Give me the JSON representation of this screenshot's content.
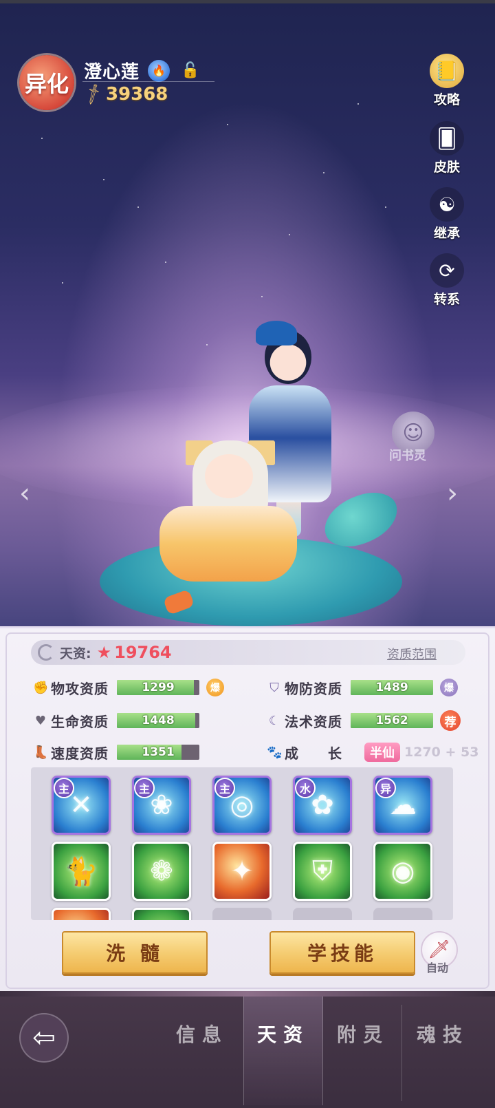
{
  "header": {
    "variant_badge": "异化",
    "pet_name": "澄心莲",
    "element_icon": "blue-flame-icon",
    "power": "39368"
  },
  "side_menu": [
    {
      "label": "攻略",
      "icon": "guide-book-icon"
    },
    {
      "label": "皮肤",
      "icon": "skin-card-icon"
    },
    {
      "label": "继承",
      "icon": "inherit-swirl-icon"
    },
    {
      "label": "转系",
      "icon": "switch-element-icon"
    }
  ],
  "spirit_label": "问书灵",
  "talent": {
    "label": "天资:",
    "value": "19764",
    "range_link": "资质范围"
  },
  "stats": {
    "attack": {
      "label": "物攻资质",
      "value": "1299",
      "fill": 0.93,
      "tag": "爆"
    },
    "defense": {
      "label": "物防资质",
      "value": "1489",
      "fill": 1.0,
      "tag": "爆"
    },
    "hp": {
      "label": "生命资质",
      "value": "1448",
      "fill": 0.95
    },
    "magic": {
      "label": "法术资质",
      "value": "1562",
      "fill": 1.0,
      "tag": "荐"
    },
    "speed": {
      "label": "速度资质",
      "value": "1351",
      "fill": 0.78
    },
    "growth": {
      "label": "成　　长",
      "rank": "半仙",
      "value": "1270 + 53"
    }
  },
  "skills": [
    {
      "tag": "主",
      "style": "main",
      "icon": "slash-skill-icon"
    },
    {
      "tag": "主",
      "style": "main",
      "icon": "lotus-skill-icon"
    },
    {
      "tag": "主",
      "style": "main",
      "icon": "wave-skill-icon"
    },
    {
      "tag": "水",
      "style": "main",
      "icon": "lotus-bud-skill-icon"
    },
    {
      "tag": "异",
      "style": "main",
      "icon": "spirit-skill-icon"
    },
    {
      "tag": "",
      "style": "green",
      "icon": "cat-spirit-skill-icon"
    },
    {
      "tag": "",
      "style": "green",
      "icon": "green-lotus-skill-icon"
    },
    {
      "tag": "",
      "style": "fire",
      "icon": "flame-skill-icon"
    },
    {
      "tag": "",
      "style": "green",
      "icon": "shield-skill-icon"
    },
    {
      "tag": "",
      "style": "green",
      "icon": "swirl-skill-icon"
    }
  ],
  "buttons": {
    "wash": "洗 髓",
    "learn": "学技能",
    "auto": "自动"
  },
  "tabs": [
    {
      "label": "信息",
      "active": false
    },
    {
      "label": "天资",
      "active": true
    },
    {
      "label": "附灵",
      "active": false
    },
    {
      "label": "魂技",
      "active": false
    }
  ],
  "colors": {
    "accent_gold": "#f5cd73",
    "talent_red": "#ef4f5e",
    "bar_green": "#5fb459",
    "growth_pink": "#ef6a9d"
  }
}
